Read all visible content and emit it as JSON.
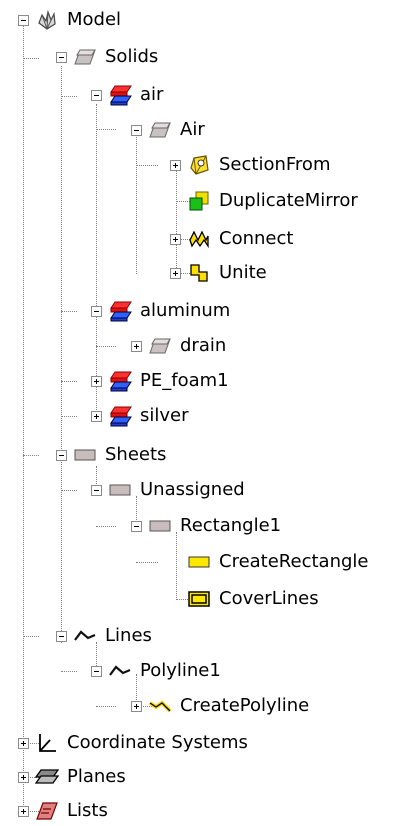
{
  "tree": {
    "model": {
      "label": "Model"
    },
    "solids": {
      "label": "Solids"
    },
    "air": {
      "label": "air"
    },
    "air_obj": {
      "label": "Air"
    },
    "sectionfrom": {
      "label": "SectionFrom"
    },
    "duplicatemirror": {
      "label": "DuplicateMirror"
    },
    "connect": {
      "label": "Connect"
    },
    "unite": {
      "label": "Unite"
    },
    "aluminum": {
      "label": "aluminum"
    },
    "drain": {
      "label": "drain"
    },
    "pe_foam1": {
      "label": "PE_foam1"
    },
    "silver": {
      "label": "silver"
    },
    "sheets": {
      "label": "Sheets"
    },
    "unassigned": {
      "label": "Unassigned"
    },
    "rectangle1": {
      "label": "Rectangle1"
    },
    "createrectangle": {
      "label": "CreateRectangle"
    },
    "coverlines": {
      "label": "CoverLines"
    },
    "lines": {
      "label": "Lines"
    },
    "polyline1": {
      "label": "Polyline1"
    },
    "createpolyline": {
      "label": "CreatePolyline"
    },
    "coordinate_systems": {
      "label": "Coordinate Systems"
    },
    "planes": {
      "label": "Planes"
    },
    "lists": {
      "label": "Lists"
    }
  },
  "icons": {
    "model": "model-icon",
    "solid": "solid-icon",
    "material": "material-icon",
    "section": "section-icon",
    "duplicate": "duplicate-mirror-icon",
    "connect": "connect-icon",
    "unite": "unite-icon",
    "sheet": "sheet-icon",
    "rectangle": "create-rectangle-icon",
    "coverlines": "cover-lines-icon",
    "line": "line-icon",
    "polyline": "create-polyline-icon",
    "coordinate": "coordinate-systems-icon",
    "planes": "planes-icon",
    "lists": "lists-icon"
  }
}
